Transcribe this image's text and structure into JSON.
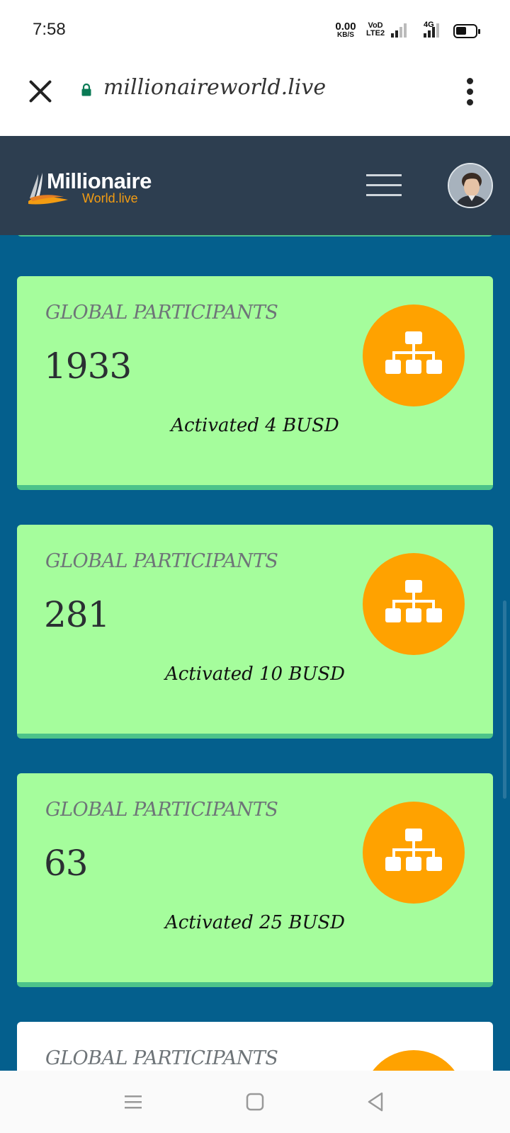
{
  "status_bar": {
    "time": "7:58",
    "net_speed_value": "0.00",
    "net_speed_unit": "KB/S",
    "volte_line1": "VoD",
    "volte_line2": "LTE2",
    "network_type": "4G"
  },
  "browser": {
    "url": "millionaireworld.live"
  },
  "header": {
    "logo_main": "Millionaire",
    "logo_sub": "World.live"
  },
  "cards": [
    {
      "title": "GLOBAL PARTICIPANTS",
      "count": "1933",
      "subtitle": "Activated 4 BUSD"
    },
    {
      "title": "GLOBAL PARTICIPANTS",
      "count": "281",
      "subtitle": "Activated 10 BUSD"
    },
    {
      "title": "GLOBAL PARTICIPANTS",
      "count": "63",
      "subtitle": "Activated 25 BUSD"
    },
    {
      "title": "GLOBAL PARTICIPANTS"
    }
  ],
  "colors": {
    "header_bg": "#2d3e50",
    "content_bg": "#045f8d",
    "card_bg": "#a5fd9c",
    "card_border": "#4cc38a",
    "icon_circle": "#ffa200",
    "logo_accent": "#f39c12"
  },
  "icons": {
    "card_icon": "org-chart-icon",
    "close": "close-icon",
    "lock": "lock-icon",
    "menu": "more-vert-icon",
    "hamburger": "hamburger-menu-icon"
  }
}
